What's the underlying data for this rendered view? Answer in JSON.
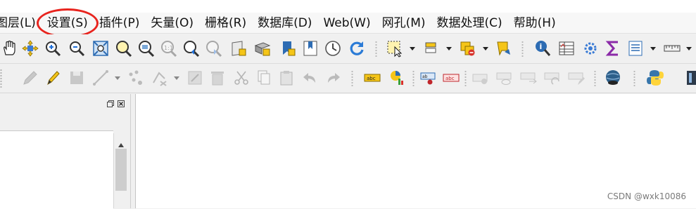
{
  "menu": {
    "items": [
      {
        "label": "图层(L)"
      },
      {
        "label": "设置(S)"
      },
      {
        "label": "插件(P)"
      },
      {
        "label": "矢量(O)"
      },
      {
        "label": "栅格(R)"
      },
      {
        "label": "数据库(D)"
      },
      {
        "label": "Web(W)"
      },
      {
        "label": "网孔(M)"
      },
      {
        "label": "数据处理(C)"
      },
      {
        "label": "帮助(H)"
      }
    ],
    "highlighted": "设置(S)",
    "highlight_color": "#e8241e"
  },
  "toolbar1": {
    "icons": [
      "pan-icon",
      "pan-to-selection-icon",
      "zoom-in-icon",
      "zoom-out-icon",
      "zoom-full-icon",
      "zoom-to-selection-icon",
      "zoom-to-layer-icon",
      "zoom-native-icon",
      "zoom-last-icon",
      "zoom-next-icon",
      "new-map-view-icon",
      "new-3d-view-icon",
      "new-bookmark-icon",
      "show-bookmarks-icon",
      "temporal-controller-icon",
      "refresh-icon",
      "select-features-icon",
      "select-by-value-icon",
      "deselect-icon",
      "select-location-icon",
      "identify-icon",
      "attribute-table-icon",
      "processing-toolbox-icon",
      "statistics-sigma-icon",
      "field-calculator-icon",
      "measure-icon"
    ]
  },
  "toolbar2": {
    "icons": [
      "digitize-icon",
      "toggle-editing-icon",
      "save-edits-icon",
      "add-line-icon",
      "vertex-tool-icon",
      "delete-selected-icon",
      "cut-icon",
      "copy-icon",
      "paste-icon",
      "undo-icon",
      "redo-icon",
      "label-abc-icon",
      "diagram-icon",
      "pin-label-icon",
      "highlight-pinned-icon",
      "show-hide-labels-icon",
      "move-label-icon",
      "rotate-label-icon",
      "change-label-icon",
      "globe-plugin-icon",
      "python-console-icon"
    ]
  },
  "watermark": {
    "text": "CSDN @wxk10086"
  },
  "colors": {
    "menubar_bg": "#f7f7f7",
    "toolbar_bg": "#f0f0f0",
    "canvas_bg": "#ffffff"
  }
}
